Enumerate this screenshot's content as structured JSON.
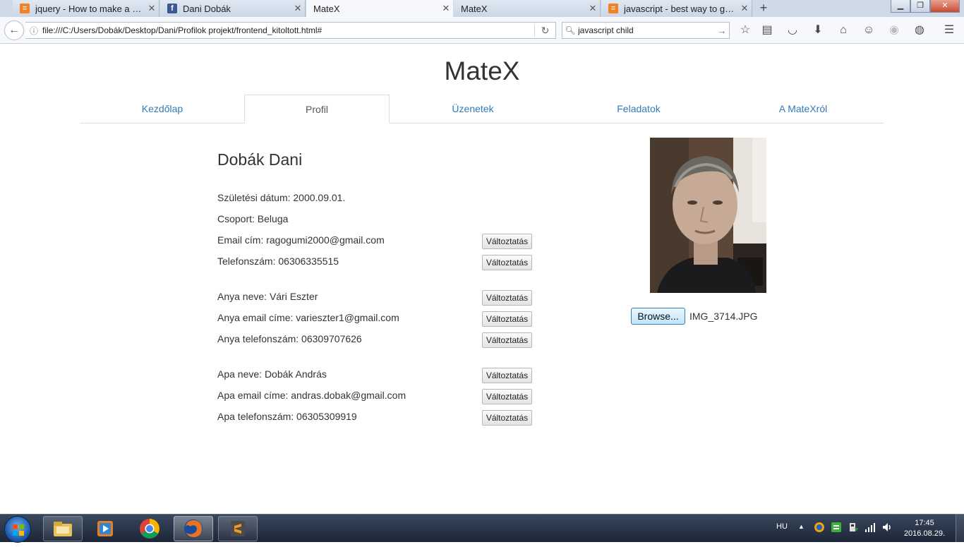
{
  "browser": {
    "tabs": [
      {
        "title": "jquery - How to make a si...",
        "favicon": "stackoverflow-icon",
        "active": false
      },
      {
        "title": "Dani Dobák",
        "favicon": "facebook-icon",
        "active": false
      },
      {
        "title": "MateX",
        "favicon": "none",
        "active": true
      },
      {
        "title": "MateX",
        "favicon": "none",
        "active": false
      },
      {
        "title": "javascript - best way to get...",
        "favicon": "stackoverflow-icon",
        "active": false
      }
    ],
    "url": "file:///C:/Users/Dobák/Desktop/Dani/Profilok projekt/frontend_kitoltott.html#",
    "search_value": "javascript child",
    "toolbar_icons": [
      "bookmark-star-icon",
      "reading-list-icon",
      "pocket-icon",
      "download-icon",
      "home-icon",
      "chat-icon",
      "sync-icon",
      "globe-icon",
      "menu-icon"
    ]
  },
  "page": {
    "site_title": "MateX",
    "nav": {
      "home": "Kezdőlap",
      "profile": "Profil",
      "messages": "Üzenetek",
      "tasks": "Feladatok",
      "about": "A MateXról"
    },
    "profile": {
      "name": "Dobák Dani",
      "birth_date": "Születési dátum: 2000.09.01.",
      "group": "Csoport: Beluga",
      "email": "Email cím: ragogumi2000@gmail.com",
      "phone": "Telefonszám: 06306335515",
      "mother_name": "Anya neve: Vári Eszter",
      "mother_email": "Anya email címe: varieszter1@gmail.com",
      "mother_phone": "Anya telefonszám: 06309707626",
      "father_name": "Apa neve: Dobák András",
      "father_email": "Apa email címe: andras.dobak@gmail.com",
      "father_phone": "Apa telefonszám: 06305309919",
      "change_label": "Változtatás"
    },
    "upload": {
      "browse_label": "Browse...",
      "file_name": "IMG_3714.JPG"
    }
  },
  "taskbar": {
    "pinned": [
      "file-explorer-icon",
      "media-player-icon",
      "chrome-icon",
      "firefox-icon",
      "sublime-text-icon"
    ],
    "language": "HU",
    "time": "17:45",
    "date": "2016.08.29."
  },
  "colors": {
    "link": "#337ab7",
    "text": "#333333",
    "taskbar": "#1c2638"
  }
}
